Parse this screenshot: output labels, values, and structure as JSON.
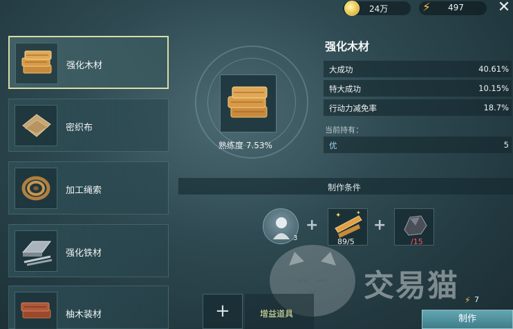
{
  "topbar": {
    "gold_amount": "24万",
    "energy_amount": "497",
    "close_icon": "close-icon"
  },
  "recipe_list": [
    {
      "label": "强化木材",
      "icon": "wood-planks-icon",
      "selected": true
    },
    {
      "label": "密织布",
      "icon": "cloth-icon",
      "selected": false
    },
    {
      "label": "加工绳索",
      "icon": "rope-icon",
      "selected": false
    },
    {
      "label": "强化铁材",
      "icon": "iron-ingot-icon",
      "selected": false
    },
    {
      "label": "柚木装材",
      "icon": "teak-planks-icon",
      "selected": false
    }
  ],
  "detail": {
    "title": "强化木材",
    "proficiency": "熟练度 7.53%",
    "stats": [
      {
        "key": "大成功",
        "value": "40.61%"
      },
      {
        "key": "特大成功",
        "value": "10.15%"
      },
      {
        "key": "行动力减免率",
        "value": "18.7%"
      }
    ],
    "holding_label": "当前持有：",
    "holding": {
      "key": "优",
      "value": "5"
    }
  },
  "conditions": {
    "title": "制作条件",
    "character_count": "3",
    "materials": [
      {
        "icon": "wood-material-icon",
        "count": "89/5",
        "insufficient": false
      },
      {
        "icon": "ore-icon",
        "count": "/15",
        "insufficient": true
      }
    ]
  },
  "bottom": {
    "add_label": "+",
    "boost_label": "增益道具",
    "energy_cost": "7",
    "make_label": "制作"
  },
  "watermark": {
    "text": "交易猫"
  },
  "colors": {
    "gold": "#e9c24a",
    "energy": "#f6c042",
    "button": "#4f8e9c",
    "insufficient": "#ff5b5b"
  }
}
